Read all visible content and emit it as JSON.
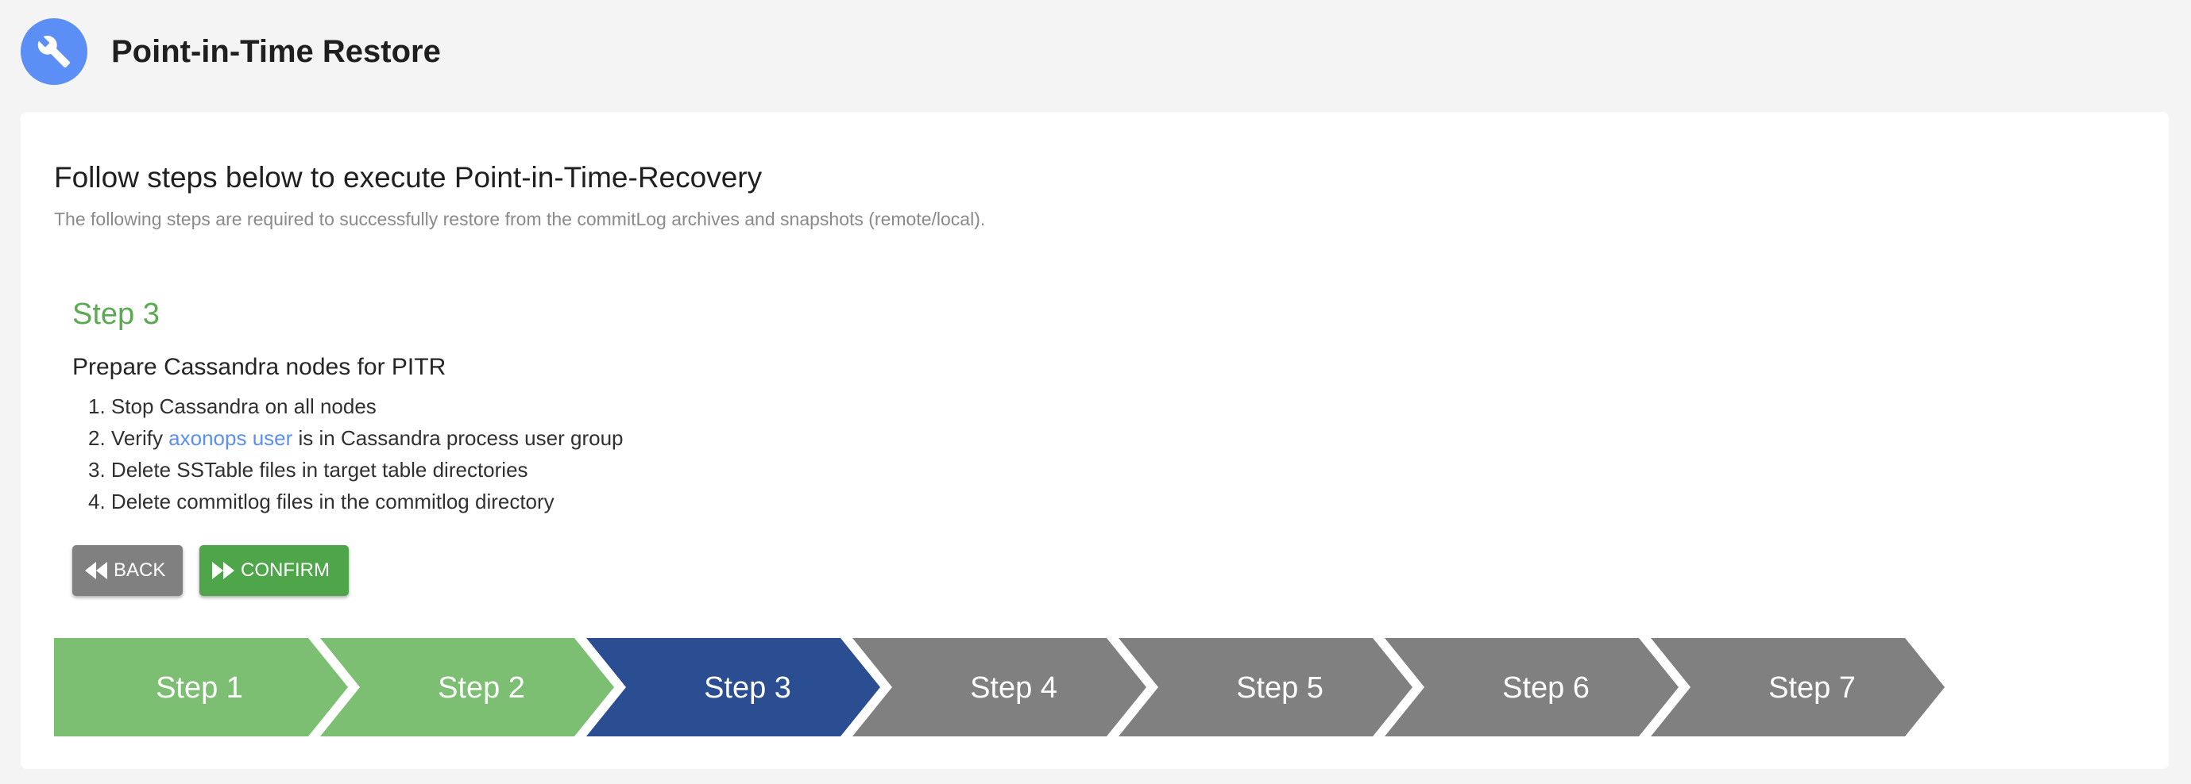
{
  "header": {
    "title": "Point-in-Time Restore",
    "icon": "wrench-icon",
    "icon_color": "#5b8ff5"
  },
  "card": {
    "title": "Follow steps below to execute Point-in-Time-Recovery",
    "subtitle": "The following steps are required to successfully restore from the commitLog archives and snapshots (remote/local)."
  },
  "current_step": {
    "heading": "Step 3",
    "description": "Prepare Cassandra nodes for PITR",
    "items": [
      {
        "num": "1.",
        "text": "Stop Cassandra on all nodes"
      },
      {
        "num": "2.",
        "before": "Verify ",
        "link": "axonops user",
        "after": " is in Cassandra process user group"
      },
      {
        "num": "3.",
        "text": "Delete SSTable files in target table directories"
      },
      {
        "num": "4.",
        "text": "Delete commitlog files in the commitlog directory"
      }
    ]
  },
  "buttons": {
    "back_label": "BACK",
    "confirm_label": "CONFIRM"
  },
  "stepper": {
    "steps": [
      {
        "label": "Step 1",
        "status": "completed"
      },
      {
        "label": "Step 2",
        "status": "completed"
      },
      {
        "label": "Step 3",
        "status": "active"
      },
      {
        "label": "Step 4",
        "status": "pending"
      },
      {
        "label": "Step 5",
        "status": "pending"
      },
      {
        "label": "Step 6",
        "status": "pending"
      },
      {
        "label": "Step 7",
        "status": "pending"
      }
    ]
  },
  "colors": {
    "completed": "#7cbf72",
    "active": "#2b4d91",
    "pending": "#808080",
    "step_heading": "#5aaa52",
    "link": "#5b8ff5",
    "confirm": "#4ea54a",
    "back": "#808080"
  }
}
